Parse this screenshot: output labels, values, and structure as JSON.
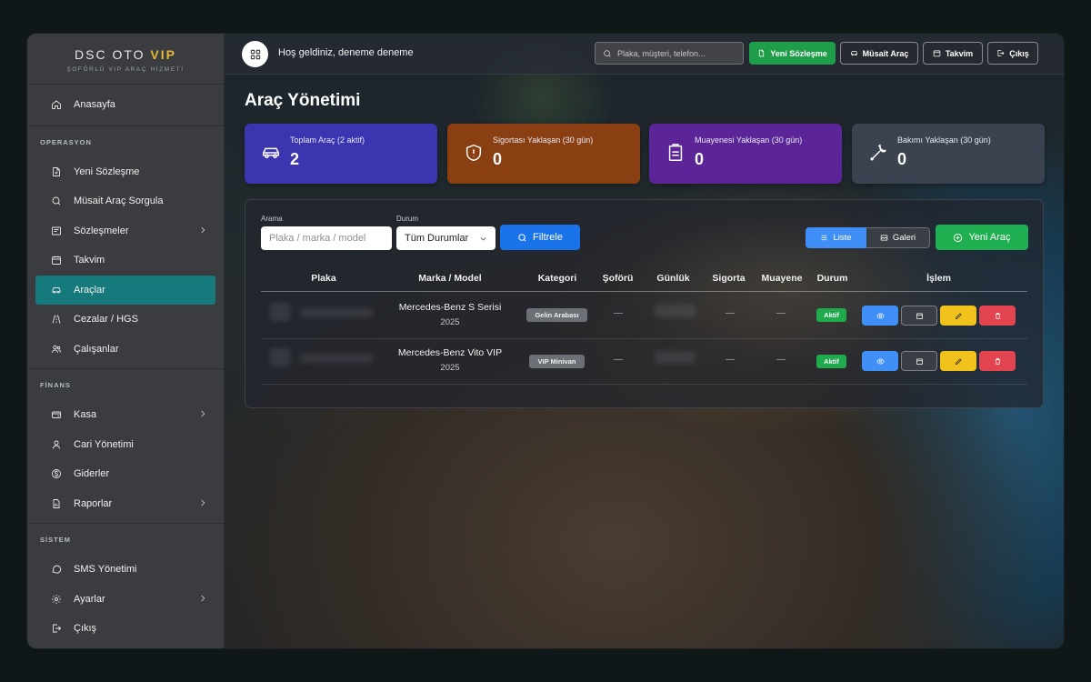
{
  "brand": {
    "name": "DSC OTO",
    "vip": "VIP",
    "subtitle": "ŞOFÖRLÜ VIP ARAÇ HİZMETİ"
  },
  "sidebar": {
    "home": "Anasayfa",
    "sections": [
      {
        "title": "OPERASYON",
        "items": [
          "Yeni Sözleşme",
          "Müsait Araç Sorgula",
          "Sözleşmeler",
          "Takvim",
          "Araçlar",
          "Cezalar / HGS",
          "Çalışanlar"
        ]
      },
      {
        "title": "FİNANS",
        "items": [
          "Kasa",
          "Cari Yönetimi",
          "Giderler",
          "Raporlar"
        ]
      },
      {
        "title": "SİSTEM",
        "items": [
          "SMS Yönetimi",
          "Ayarlar",
          "Çıkış"
        ]
      }
    ]
  },
  "topbar": {
    "welcome": "Hoş geldiniz, deneme deneme",
    "search_placeholder": "Plaka, müşteri, telefon...",
    "btn_new_contract": "Yeni Sözleşme",
    "btn_available": "Müsait Araç",
    "btn_calendar": "Takvim",
    "btn_logout": "Çıkış"
  },
  "page": {
    "title": "Araç Yönetimi"
  },
  "stats": [
    {
      "label": "Toplam Araç (2 aktif)",
      "value": "2",
      "color": "#3b35b0"
    },
    {
      "label": "Sigortası Yaklaşan (30 gün)",
      "value": "0",
      "color": "#8a3f13"
    },
    {
      "label": "Muayenesi Yaklaşan (30 gün)",
      "value": "0",
      "color": "#5c2597"
    },
    {
      "label": "Bakımı Yaklaşan (30 gün)",
      "value": "0",
      "color": "#3b4350"
    }
  ],
  "filters": {
    "search_label": "Arama",
    "search_placeholder": "Plaka / marka / model",
    "status_label": "Durum",
    "status_value": "Tüm Durumlar",
    "filter_button": "Filtrele",
    "view_list": "Liste",
    "view_gallery": "Galeri",
    "new_vehicle": "Yeni Araç"
  },
  "table": {
    "headers": [
      "Plaka",
      "Marka / Model",
      "Kategori",
      "Şoförü",
      "Günlük",
      "Sigorta",
      "Muayene",
      "Durum",
      "İşlem"
    ],
    "rows": [
      {
        "model": "Mercedes-Benz S Serisi",
        "year": "2025",
        "category": "Gelin Arabası",
        "driver": "—",
        "insurance": "—",
        "inspection": "—",
        "status": "Aktif"
      },
      {
        "model": "Mercedes-Benz Vito VIP",
        "year": "2025",
        "category": "VIP Minivan",
        "driver": "—",
        "insurance": "—",
        "inspection": "—",
        "status": "Aktif"
      }
    ]
  },
  "colors": {
    "active_nav": "#167a7c",
    "green": "#1f9e4a",
    "blue": "#1a73e8",
    "yellow": "#f1c21b",
    "red": "#e2454f"
  }
}
